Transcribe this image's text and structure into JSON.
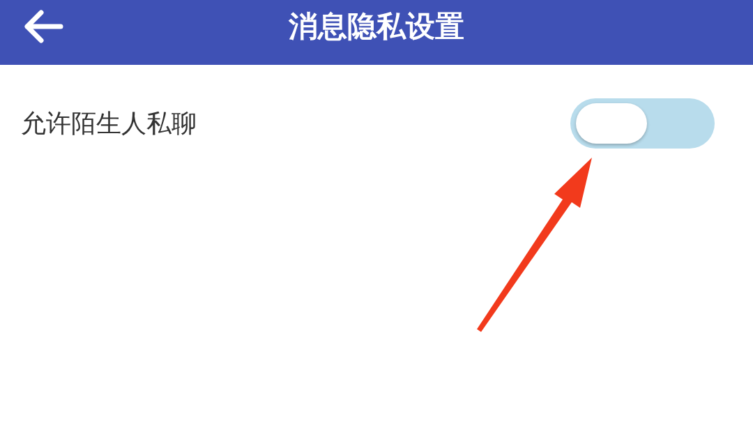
{
  "header": {
    "title": "消息隐私设置"
  },
  "settings": [
    {
      "label": "允许陌生人私聊",
      "kind": "toggle",
      "on": false
    }
  ],
  "annotations": [
    {
      "kind": "arrow"
    }
  ]
}
